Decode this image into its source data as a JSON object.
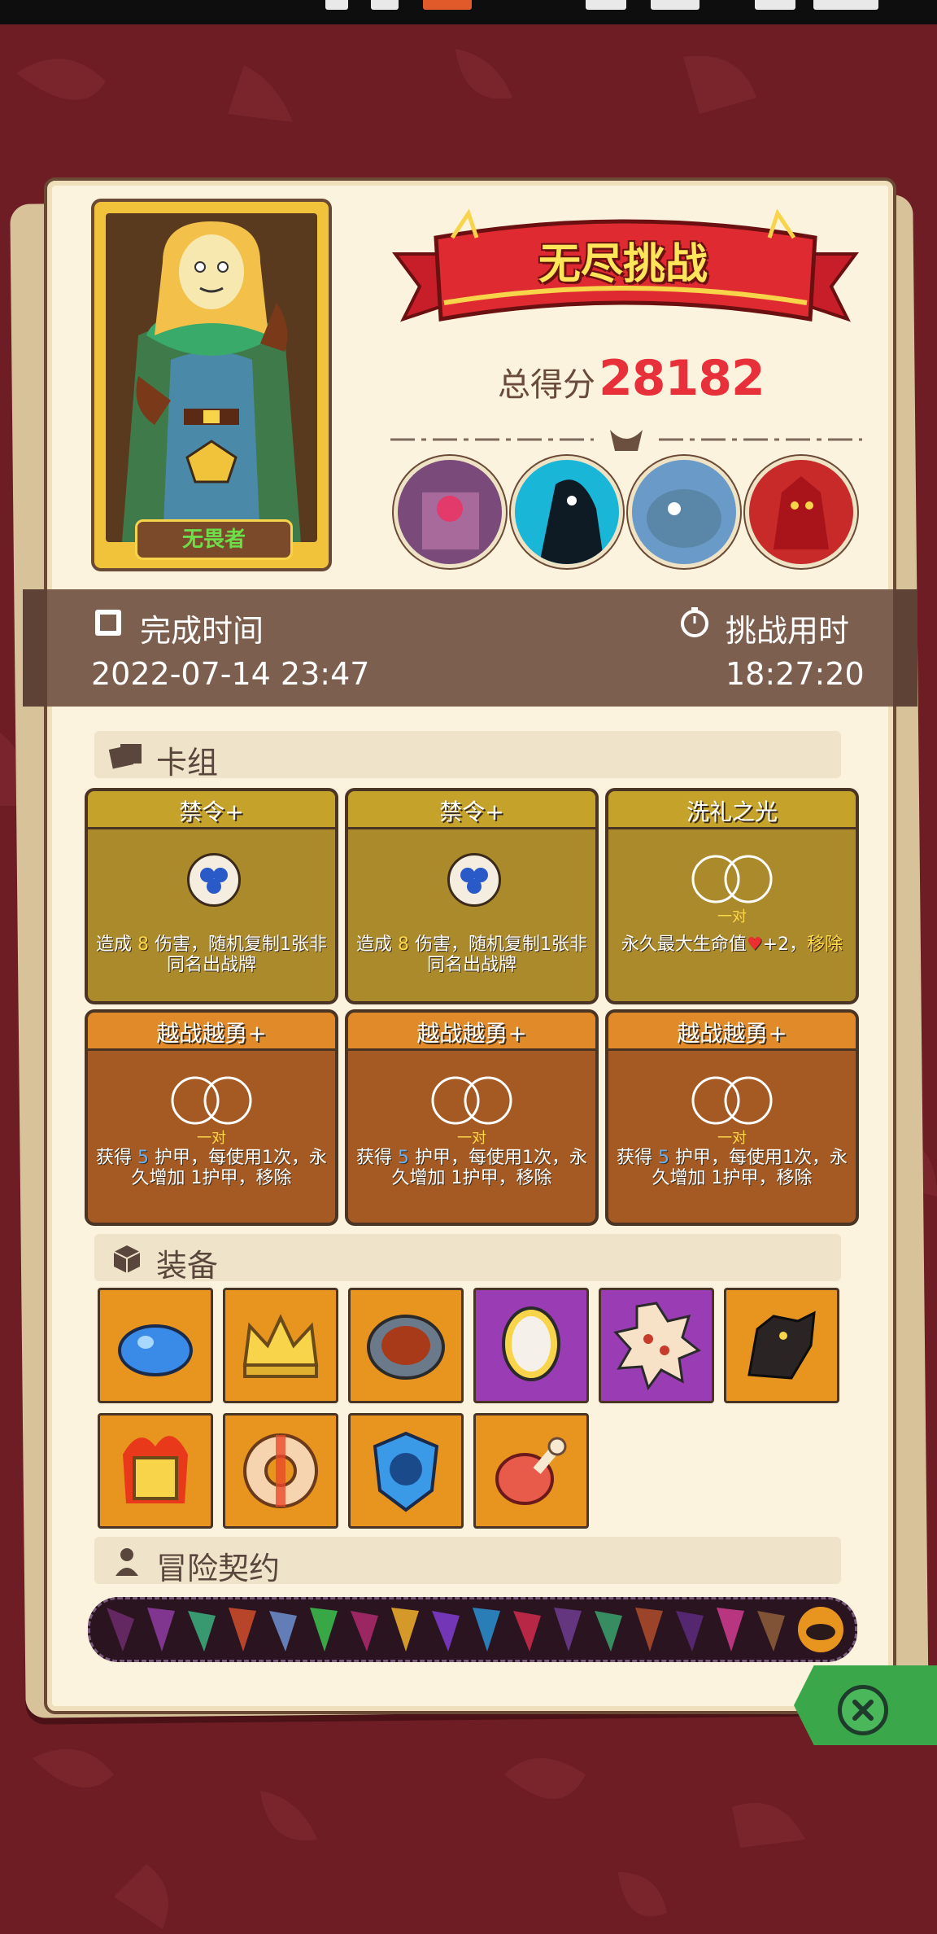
{
  "title": "无尽挑战",
  "score": {
    "label": "总得分",
    "value": "28182"
  },
  "hero": {
    "name": "无畏者"
  },
  "time": {
    "completed_label": "完成时间",
    "completed_value": "2022-07-14 23:47",
    "duration_label": "挑战用时",
    "duration_value": "18:27:20"
  },
  "sections": {
    "deck": "卡组",
    "equipment": "装备",
    "contracts": "冒险契约"
  },
  "cards": [
    {
      "title": "禁令+",
      "style": "gold",
      "icon": "blue-triple-orb-icon",
      "desc_prefix": "造成 ",
      "desc_num": "8",
      "desc_rest": " 伤害，随机复制1张非同名出战牌"
    },
    {
      "title": "禁令+",
      "style": "gold",
      "icon": "blue-triple-orb-icon",
      "desc_prefix": "造成 ",
      "desc_num": "8",
      "desc_rest": " 伤害，随机复制1张非同名出战牌"
    },
    {
      "title": "洗礼之光",
      "style": "gold",
      "icon": "pair-icon",
      "pair": "一对",
      "desc_prefix": "永久最大生命值",
      "desc_num": "+2，",
      "desc_rest": "移除"
    },
    {
      "title": "越战越勇+",
      "style": "orange",
      "icon": "pair-icon",
      "pair": "一对",
      "desc_prefix": "获得 ",
      "desc_num": "5",
      "desc_rest": " 护甲，每使用1次，永久增加 1护甲，移除"
    },
    {
      "title": "越战越勇+",
      "style": "orange",
      "icon": "pair-icon",
      "pair": "一对",
      "desc_prefix": "获得 ",
      "desc_num": "5",
      "desc_rest": " 护甲，每使用1次，永久增加 1护甲，移除"
    },
    {
      "title": "越战越勇+",
      "style": "orange",
      "icon": "pair-icon",
      "pair": "一对",
      "desc_prefix": "获得 ",
      "desc_num": "5",
      "desc_rest": " 护甲，每使用1次，永久增加 1护甲，移除"
    }
  ],
  "equipment": [
    {
      "name": "blue-slime-icon",
      "bg": "orange"
    },
    {
      "name": "crown-icon",
      "bg": "orange"
    },
    {
      "name": "bronze-disc-icon",
      "bg": "orange"
    },
    {
      "name": "mirror-icon",
      "bg": "purple"
    },
    {
      "name": "spiked-dice-icon",
      "bg": "purple"
    },
    {
      "name": "wolf-head-icon",
      "bg": "orange"
    },
    {
      "name": "flaming-cube-icon",
      "bg": "orange"
    },
    {
      "name": "lifebuoy-icon",
      "bg": "orange"
    },
    {
      "name": "pumpkin-shield-icon",
      "bg": "orange"
    },
    {
      "name": "meat-leg-icon",
      "bg": "orange"
    }
  ],
  "colors": {
    "score": "#e8303a",
    "accent": "#ffd84a",
    "panel": "#fbf3dd"
  }
}
